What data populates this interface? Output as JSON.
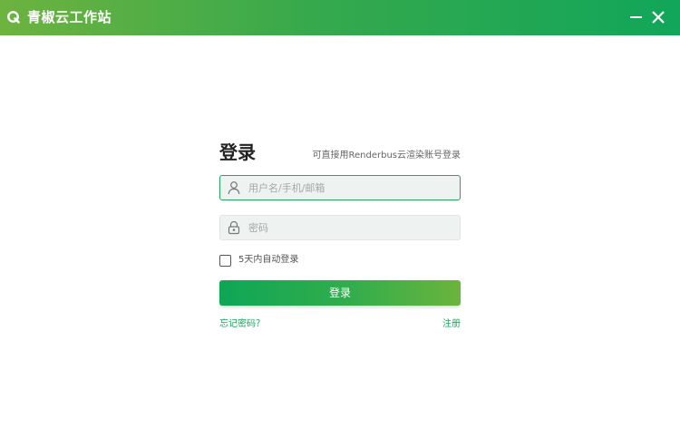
{
  "window": {
    "title": "青椒云工作站",
    "logo_icon": "app-logo-icon",
    "minimize_icon": "minimize-icon",
    "close_icon": "close-icon"
  },
  "login": {
    "heading": "登录",
    "hint": "可直接用Renderbus云渲染账号登录",
    "username": {
      "placeholder": "用户名/手机/邮箱",
      "value": "",
      "icon": "user-icon"
    },
    "password": {
      "placeholder": "密码",
      "value": "",
      "icon": "lock-icon"
    },
    "remember": {
      "label": "5天内自动登录",
      "checked": false
    },
    "submit_label": "登录",
    "forgot_label": "忘记密码？",
    "register_label": "注册"
  },
  "colors": {
    "brand_green": "#11a65a",
    "brand_lime": "#6db33f",
    "link_green": "#1aa65b"
  }
}
